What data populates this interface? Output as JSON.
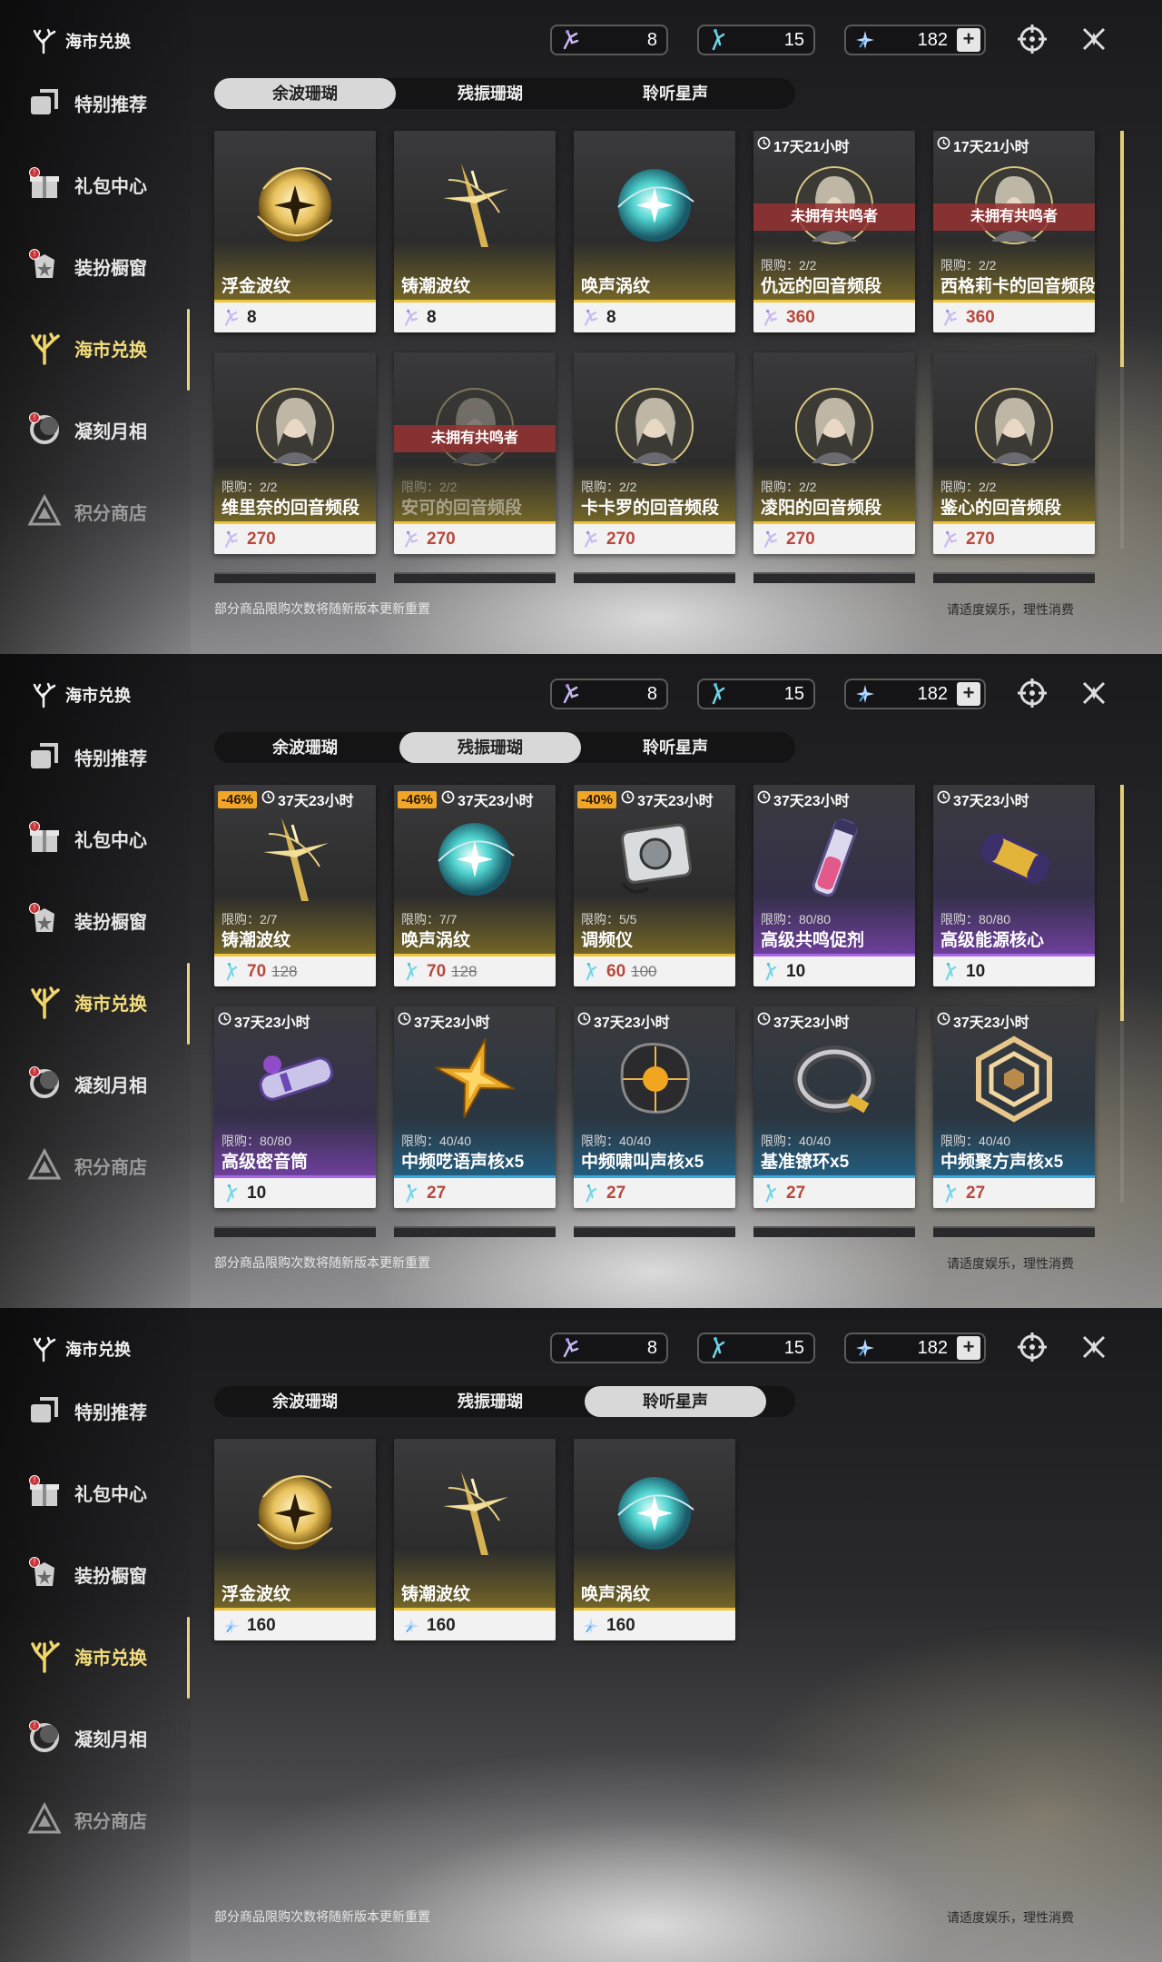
{
  "logo_title": "海市兑换",
  "nav": [
    {
      "label": "特别推荐",
      "icon": "featured-icon",
      "dot": false
    },
    {
      "label": "礼包中心",
      "icon": "gift-icon",
      "dot": true
    },
    {
      "label": "装扮橱窗",
      "icon": "outfit-icon",
      "dot": true
    },
    {
      "label": "海市兑换",
      "icon": "coral-icon",
      "dot": false,
      "active": true
    },
    {
      "label": "凝刻月相",
      "icon": "moon-icon",
      "dot": true
    },
    {
      "label": "积分商店",
      "icon": "points-icon",
      "dot": false,
      "dim": true
    }
  ],
  "currency": {
    "afterglow": "8",
    "oscillated": "15",
    "lustrous": "182",
    "plus": "+"
  },
  "tabs": [
    "余波珊瑚",
    "残振珊瑚",
    "聆听星声"
  ],
  "notes": {
    "left": "部分商品限购次数将随新版本更新重置",
    "right": "请适度娱乐，理性消费"
  },
  "panels": [
    {
      "selected_tab": 0,
      "cards": [
        {
          "name": "浮金波纹",
          "price": "8",
          "currency": "afterglow",
          "theme": "gold",
          "art": "gold-orb"
        },
        {
          "name": "铸潮波纹",
          "price": "8",
          "currency": "afterglow",
          "theme": "gold",
          "art": "sword"
        },
        {
          "name": "唤声涡纹",
          "price": "8",
          "currency": "afterglow",
          "theme": "gold",
          "art": "cyan-orb"
        },
        {
          "name": "仇远的回音频段",
          "price": "360",
          "currency": "afterglow",
          "theme": "gold",
          "art": "portrait",
          "timer": "17天21小时",
          "limit": "限购：2/2",
          "banner": "未拥有共鸣者",
          "red": true
        },
        {
          "name": "西格莉卡的回音频段",
          "price": "360",
          "currency": "afterglow",
          "theme": "gold",
          "art": "portrait",
          "timer": "17天21小时",
          "limit": "限购：2/2",
          "banner": "未拥有共鸣者",
          "red": true
        },
        {
          "name": "维里奈的回音频段",
          "price": "270",
          "currency": "afterglow",
          "theme": "gold",
          "art": "portrait",
          "limit": "限购：2/2",
          "red": true
        },
        {
          "name": "安可的回音频段",
          "price": "270",
          "currency": "afterglow",
          "theme": "gold",
          "art": "portrait",
          "limit": "限购：2/2",
          "banner": "未拥有共鸣者",
          "red": true
        },
        {
          "name": "卡卡罗的回音频段",
          "price": "270",
          "currency": "afterglow",
          "theme": "gold",
          "art": "portrait",
          "limit": "限购：2/2",
          "red": true
        },
        {
          "name": "凌阳的回音频段",
          "price": "270",
          "currency": "afterglow",
          "theme": "gold",
          "art": "portrait",
          "limit": "限购：2/2",
          "red": true
        },
        {
          "name": "鉴心的回音频段",
          "price": "270",
          "currency": "afterglow",
          "theme": "gold",
          "art": "portrait",
          "limit": "限购：2/2",
          "red": true
        }
      ]
    },
    {
      "selected_tab": 1,
      "cards": [
        {
          "name": "铸潮波纹",
          "price": "70",
          "old": "128",
          "discount": "-46%",
          "timer": "37天23小时",
          "limit": "限购：2/7",
          "currency": "oscillated",
          "theme": "gold",
          "art": "sword",
          "red": true
        },
        {
          "name": "唤声涡纹",
          "price": "70",
          "old": "128",
          "discount": "-46%",
          "timer": "37天23小时",
          "limit": "限购：7/7",
          "currency": "oscillated",
          "theme": "gold",
          "art": "cyan-orb",
          "red": true
        },
        {
          "name": "调频仪",
          "price": "60",
          "old": "100",
          "discount": "-40%",
          "timer": "37天23小时",
          "limit": "限购：5/5",
          "currency": "oscillated",
          "theme": "gold",
          "art": "device",
          "red": true
        },
        {
          "name": "高级共鸣促剂",
          "price": "10",
          "timer": "37天23小时",
          "limit": "限购：80/80",
          "currency": "oscillated",
          "theme": "purple",
          "art": "vial"
        },
        {
          "name": "高级能源核心",
          "price": "10",
          "timer": "37天23小时",
          "limit": "限购：80/80",
          "currency": "oscillated",
          "theme": "purple",
          "art": "capsule"
        },
        {
          "name": "高级密音筒",
          "price": "10",
          "timer": "37天23小时",
          "limit": "限购：80/80",
          "currency": "oscillated",
          "theme": "purple",
          "art": "tube"
        },
        {
          "name": "中频呓语声核x5",
          "price": "27",
          "timer": "37天23小时",
          "limit": "限购：40/40",
          "currency": "oscillated",
          "theme": "blue",
          "art": "star-core",
          "red": true
        },
        {
          "name": "中频啸叫声核x5",
          "price": "27",
          "timer": "37天23小时",
          "limit": "限购：40/40",
          "currency": "oscillated",
          "theme": "blue",
          "art": "dark-core",
          "red": true
        },
        {
          "name": "基准镣环x5",
          "price": "27",
          "timer": "37天23小时",
          "limit": "限购：40/40",
          "currency": "oscillated",
          "theme": "blue",
          "art": "ring",
          "red": true
        },
        {
          "name": "中频聚方声核x5",
          "price": "27",
          "timer": "37天23小时",
          "limit": "限购：40/40",
          "currency": "oscillated",
          "theme": "blue",
          "art": "hex-core",
          "red": true
        }
      ]
    },
    {
      "selected_tab": 2,
      "cards": [
        {
          "name": "浮金波纹",
          "price": "160",
          "currency": "lustrous",
          "theme": "gold",
          "art": "gold-orb"
        },
        {
          "name": "铸潮波纹",
          "price": "160",
          "currency": "lustrous",
          "theme": "gold",
          "art": "sword"
        },
        {
          "name": "唤声涡纹",
          "price": "160",
          "currency": "lustrous",
          "theme": "gold",
          "art": "cyan-orb"
        }
      ]
    }
  ]
}
